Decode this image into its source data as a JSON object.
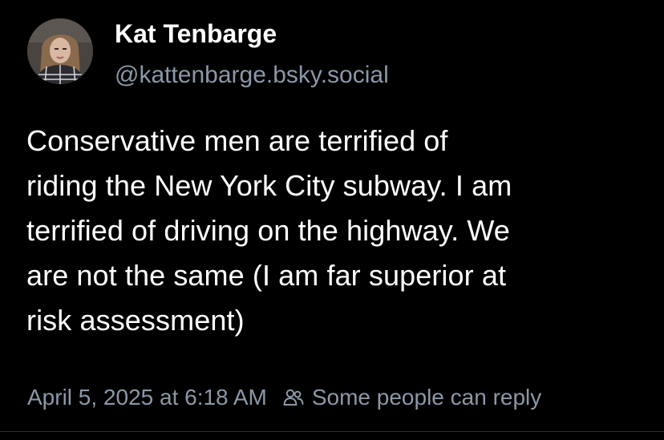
{
  "post": {
    "author": {
      "display_name": "Kat Tenbarge",
      "handle": "@kattenbarge.bsky.social",
      "avatar_icon": "profile-photo"
    },
    "text_lines": [
      "Conservative men are terrified of",
      "riding the New York City subway. I am",
      "terrified of driving on the highway. We",
      "are not the same (I am far superior at",
      "risk assessment)"
    ],
    "timestamp": "April 5, 2025 at 6:18 AM",
    "reply_setting": {
      "icon": "people-icon",
      "label": "Some people can reply"
    }
  },
  "colors": {
    "background": "#000000",
    "primary_text": "#ffffff",
    "secondary_text": "#8b98a8"
  }
}
